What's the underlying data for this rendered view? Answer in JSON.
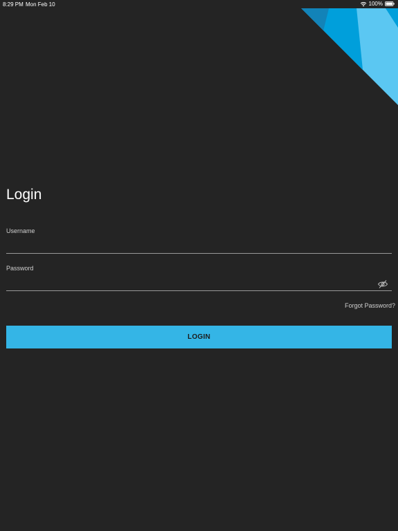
{
  "status_bar": {
    "time": "8:29 PM",
    "date": "Mon Feb 10",
    "battery": "100%",
    "icons": [
      "wifi-icon",
      "battery-icon"
    ]
  },
  "login": {
    "title": "Login",
    "username_label": "Username",
    "username_value": "",
    "password_label": "Password",
    "password_value": "",
    "password_toggle_icon": "eye-slash-icon",
    "forgot_password": "Forgot Password?",
    "login_button": "LOGIN"
  },
  "colors": {
    "background": "#242424",
    "accent": "#34b5e6",
    "decor_light": "#5bc7f2",
    "decor_mid": "#009fdb",
    "decor_dark": "#1283b8"
  }
}
